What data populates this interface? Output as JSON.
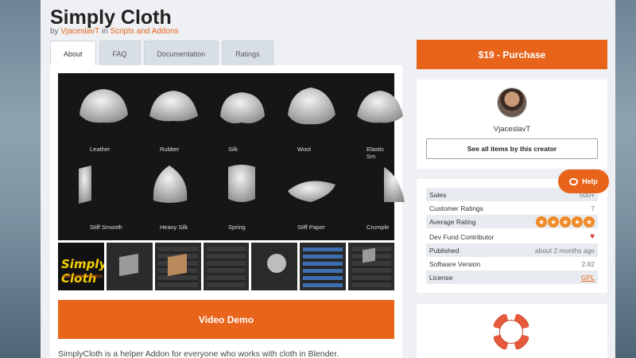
{
  "product": {
    "title": "Simply Cloth",
    "by_prefix": "by",
    "author": "VjaceslavT",
    "in_text": "in",
    "category": "Scripts and Addons"
  },
  "tabs": [
    {
      "label": "About",
      "active": true
    },
    {
      "label": "FAQ",
      "active": false
    },
    {
      "label": "Documentation",
      "active": false
    },
    {
      "label": "Ratings",
      "active": false
    }
  ],
  "hero": {
    "materials": [
      "Leather",
      "Rubber",
      "Silk",
      "Wool",
      "Elastic Sm",
      "Stiff Smooth",
      "Heavy Silk",
      "Spring",
      "Stiff Paper",
      "Crumple"
    ]
  },
  "thumbnails": {
    "first_logo": "Simply Cloth",
    "first_sub": "easy cloth creation"
  },
  "video_demo_label": "Video Demo",
  "description": "SimplyCloth is a helper Addon for everyone who works with cloth in Blender.",
  "purchase_label": "$19 - Purchase",
  "creator": {
    "name": "VjaceslavT",
    "see_all_label": "See all items by this creator"
  },
  "stats": {
    "sales": {
      "label": "Sales",
      "value": "500+"
    },
    "customer_ratings": {
      "label": "Customer Ratings",
      "value": "7"
    },
    "average_rating": {
      "label": "Average Rating",
      "value": 5,
      "max": 5
    },
    "dev_fund": {
      "label": "Dev Fund Contributor"
    },
    "published": {
      "label": "Published",
      "value": "about 2 months ago"
    },
    "software_version": {
      "label": "Software Version",
      "value": "2.82"
    },
    "license": {
      "label": "License",
      "value": "GPL"
    }
  },
  "help_label": "Help",
  "colors": {
    "accent": "#e8641b",
    "star": "#f08a24",
    "heart": "#d23a3a"
  }
}
